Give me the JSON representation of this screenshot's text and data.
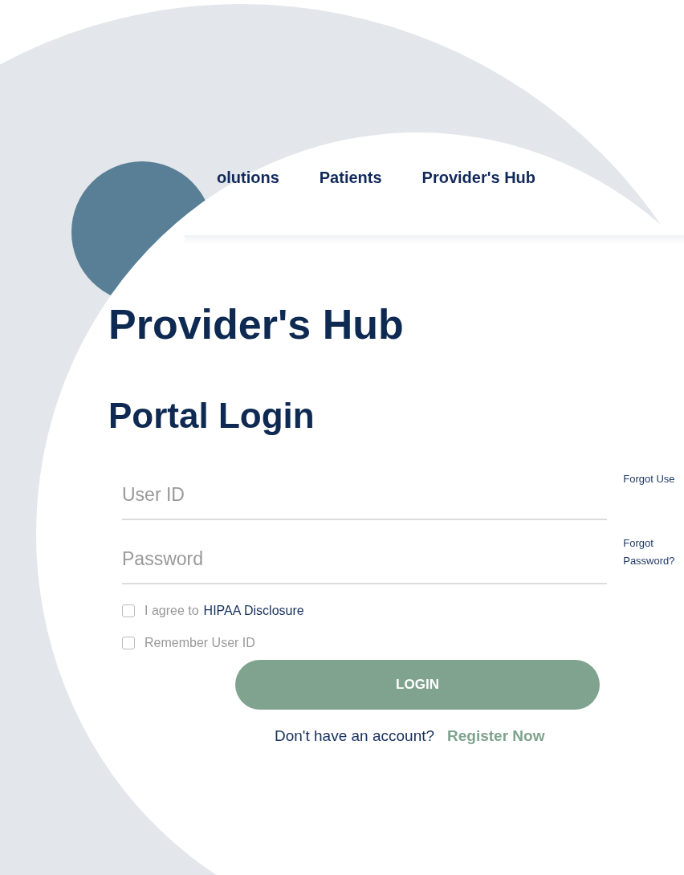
{
  "nav": {
    "items": [
      {
        "label": "olutions"
      },
      {
        "label": "Patients"
      },
      {
        "label": "Provider's Hub"
      }
    ]
  },
  "heading": "Provider's Hub",
  "subheading": "Portal Login",
  "fields": [
    {
      "placeholder": "User ID",
      "forgot": "Forgot Use"
    },
    {
      "placeholder": "Password",
      "forgot": "Forgot Password?"
    }
  ],
  "checkboxes": [
    {
      "label": "I agree to",
      "link": "HIPAA Disclosure",
      "checked": false
    },
    {
      "label": "Remember User ID",
      "checked": false
    }
  ],
  "login_button": "LOGIN",
  "register": {
    "prompt": "Don't have an account?",
    "link": "Register Now"
  }
}
